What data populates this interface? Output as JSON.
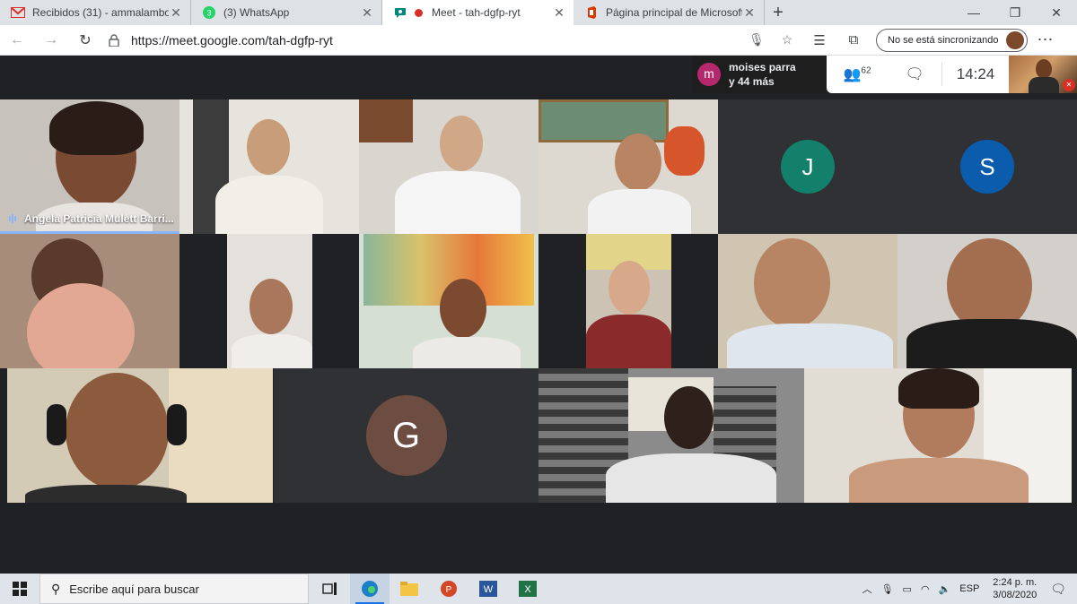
{
  "browser": {
    "tabs": [
      {
        "title": "Recibidos (31) - ammalambo@m",
        "icon": "gmail-icon"
      },
      {
        "title": "(3) WhatsApp",
        "icon": "whatsapp-icon"
      },
      {
        "title": "Meet - tah-dgfp-ryt",
        "icon": "meet-icon",
        "recording": true
      },
      {
        "title": "Página principal de Microsoft Of",
        "icon": "office-icon"
      }
    ],
    "url": "https://meet.google.com/tah-dgfp-ryt",
    "sync_label": "No se está sincronizando"
  },
  "meet": {
    "presenter_initial": "m",
    "presenter_line1": "moises parra",
    "presenter_line2": "y 44 más",
    "participants_count": "62",
    "time": "14:24",
    "speaker_name": "Angela Patricia Mulett Barri...",
    "avatars": {
      "j": "J",
      "s": "S",
      "g": "G"
    },
    "colors": {
      "j": "#12806a",
      "s": "#0b5cad",
      "g": "#6d4c41"
    }
  },
  "taskbar": {
    "search_placeholder": "Escribe aquí para buscar",
    "language": "ESP",
    "clock_time": "2:24 p. m.",
    "clock_date": "3/08/2020"
  }
}
